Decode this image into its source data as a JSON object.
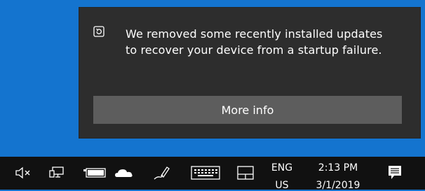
{
  "notification": {
    "icon": "system-restore-icon",
    "message": "We removed some recently installed updates to recover your device from a startup failure.",
    "button_label": "More info"
  },
  "taskbar": {
    "icons": [
      "speaker-muted-icon",
      "network-icon",
      "battery-icon",
      "onedrive-cloud-icon",
      "pen-workspace-icon",
      "touch-keyboard-icon",
      "tablet-mode-icon"
    ],
    "language": "ENG",
    "region": "US",
    "time": "2:13 PM",
    "date": "3/1/2019",
    "action_center_icon": "action-center-icon"
  },
  "colors": {
    "desktop": "#1474cf",
    "toast_background": "#2d2d2d",
    "button_background": "#5d5d5d",
    "taskbar": "#111111"
  }
}
